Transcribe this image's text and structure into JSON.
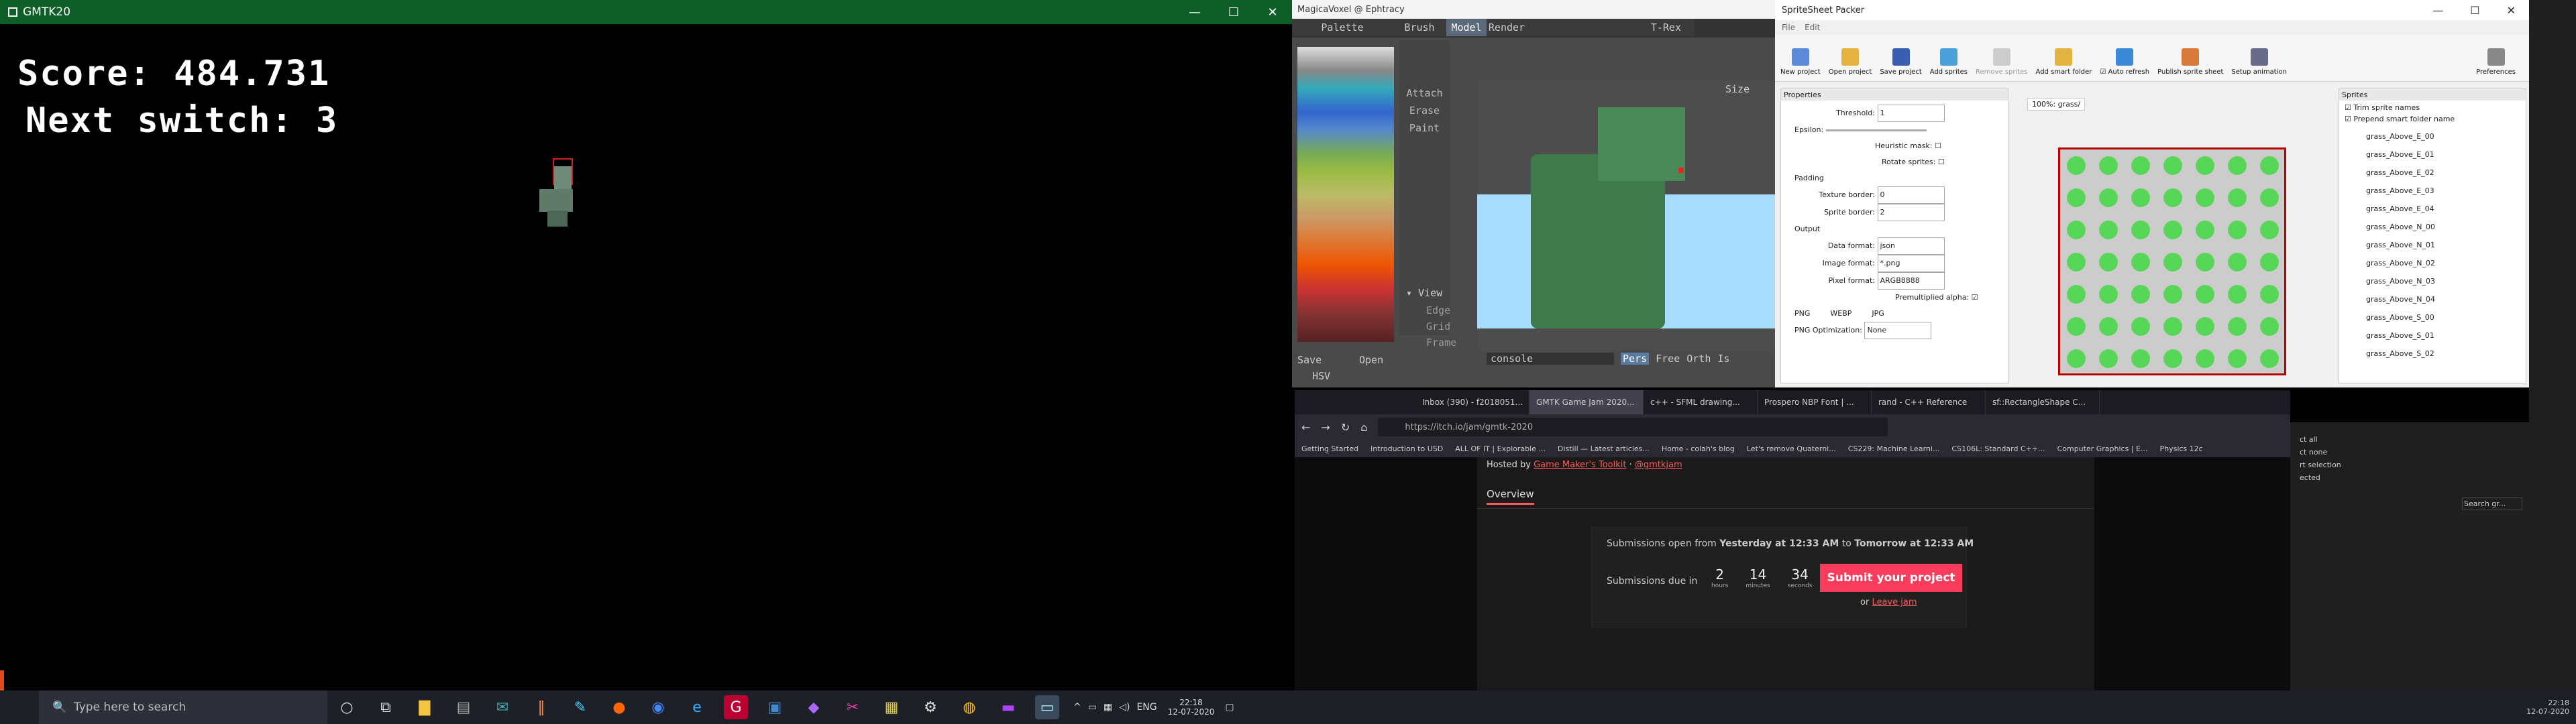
{
  "game": {
    "title": "GMTK20",
    "score": "Score: 484.731",
    "next": "Next switch: 3"
  },
  "taskbar": {
    "search_placeholder": "Type here to search",
    "lang": "ENG",
    "time": "22:18",
    "date": "12-07-2020",
    "right_time": "22:18",
    "right_date": "12-07-2020"
  },
  "magicavoxel": {
    "title": "MagicaVoxel @ Ephtracy",
    "tabs": [
      "Palette",
      "Brush",
      "Model",
      "Render",
      "T-Rex"
    ],
    "brush_modes": [
      "Attach",
      "Erase",
      "Paint"
    ],
    "size_label": "Size",
    "palette_save": "Save",
    "palette_open": "Open",
    "hsv": "HSV",
    "view_label": "View",
    "view_opts": [
      "Edge",
      "Grid",
      "Frame"
    ],
    "console": "console",
    "cam_modes": [
      "Pers",
      "Free",
      "Orth",
      "Is"
    ]
  },
  "sprite": {
    "title": "SpriteSheet Packer",
    "menu": [
      "File",
      "Edit"
    ],
    "tools": [
      "New project",
      "Open project",
      "Save project",
      "Add sprites",
      "Remove sprites",
      "Add smart folder",
      "Auto refresh",
      "Publish sprite sheet",
      "Setup animation",
      "Preferences"
    ],
    "properties": "Properties",
    "threshold_label": "Threshold:",
    "threshold": "1",
    "epsilon_label": "Epsilon:",
    "heuristic": "Heuristic mask:",
    "rotate": "Rotate sprites:",
    "padding": "Padding",
    "texture_border": "Texture border:",
    "texture_border_val": "0",
    "sprite_border": "Sprite border:",
    "sprite_border_val": "2",
    "output": "Output",
    "data_format": "Data format:",
    "data_format_val": "json",
    "image_format": "Image format:",
    "image_format_val": "*.png",
    "pixel_format": "Pixel format:",
    "pixel_format_val": "ARGB8888",
    "premult": "Premultiplied alpha:",
    "out_tabs": [
      "PNG",
      "WEBP",
      "JPG"
    ],
    "png_opt": "PNG Optimization:",
    "png_opt_val": "None",
    "preview_tab": "100%: grass/",
    "sprites_header": "Sprites",
    "trim": "Trim sprite names",
    "prepend": "Prepend smart folder name",
    "sprite_list": [
      "grass_Above_E_00",
      "grass_Above_E_01",
      "grass_Above_E_02",
      "grass_Above_E_03",
      "grass_Above_E_04",
      "grass_Above_N_00",
      "grass_Above_N_01",
      "grass_Above_N_02",
      "grass_Above_N_03",
      "grass_Above_N_04",
      "grass_Above_S_00",
      "grass_Above_S_01",
      "grass_Above_S_02"
    ]
  },
  "browser": {
    "tabs": [
      "Inbox (390) - f2018051...",
      "GMTK Game Jam 2020...",
      "c++ - SFML drawing...",
      "Prospero NBP Font | ...",
      "rand - C++ Reference",
      "sf::RectangleShape C..."
    ],
    "url": "https://itch.io/jam/gmtk-2020",
    "bookmarks": [
      "Getting Started",
      "Introduction to USD",
      "ALL OF IT | Explorable ...",
      "Distill — Latest articles...",
      "Home - colah's blog",
      "Let's remove Quaterni...",
      "CS229: Machine Learni...",
      "CS106L: Standard C++...",
      "Computer Graphics | E...",
      "Physics 12c"
    ],
    "hosted_by": "Hosted by",
    "host1": "Game Maker's Toolkit",
    "host_sep": " · ",
    "host2": "@gmtkjam",
    "overview_tab": "Overview",
    "submissions_text_pre": "Submissions open from ",
    "sub_from": "Yesterday at 12:33 AM",
    "sub_to_word": " to ",
    "sub_to": "Tomorrow at 12:33 AM",
    "due_label": "Submissions due in",
    "hours": "2",
    "hours_l": "hours",
    "minutes": "14",
    "minutes_l": "minutes",
    "seconds": "34",
    "seconds_l": "seconds",
    "submit": "Submit your project",
    "or": "or ",
    "leave": "Leave jam"
  },
  "behind": {
    "items": [
      "ct all",
      "ct none",
      "rt selection",
      "ected"
    ],
    "search": "Search gr..."
  }
}
